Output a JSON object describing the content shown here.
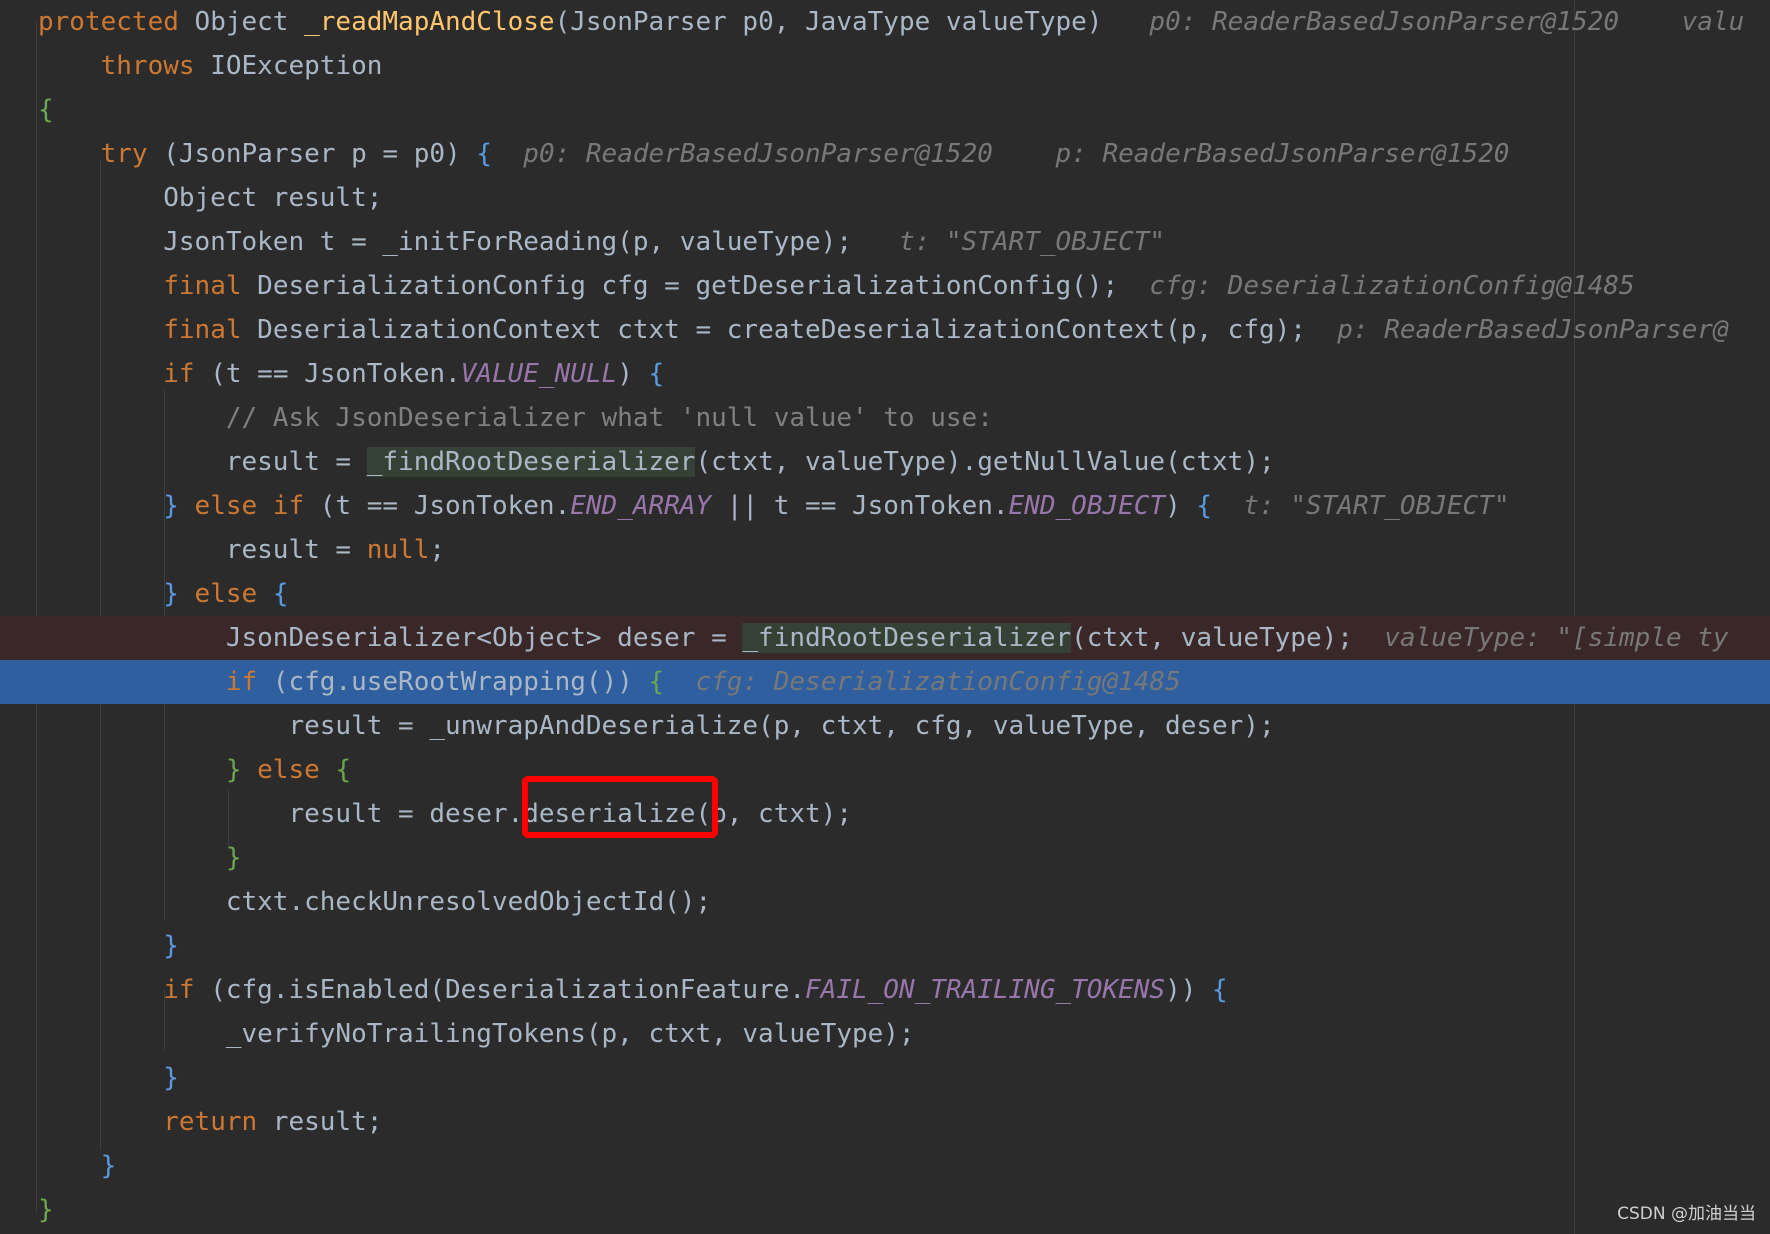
{
  "editor": {
    "lines": [
      {
        "segments": [
          {
            "t": "protected",
            "c": "kw"
          },
          {
            "t": " Object "
          },
          {
            "t": "_readMapAndClose",
            "c": "fn"
          },
          {
            "t": "(JsonParser p0, JavaType valueType)"
          },
          {
            "t": "   p0: ReaderBasedJsonParser@1520    valu",
            "c": "hint"
          }
        ]
      },
      {
        "segments": [
          {
            "t": "    "
          },
          {
            "t": "throws",
            "c": "kw"
          },
          {
            "t": " IOException"
          }
        ]
      },
      {
        "segments": [
          {
            "t": "{",
            "c": "br2"
          }
        ]
      },
      {
        "segments": [
          {
            "t": "    "
          },
          {
            "t": "try",
            "c": "kw"
          },
          {
            "t": " ("
          },
          {
            "t": "JsonParser p = p0) "
          },
          {
            "t": "{",
            "c": "br3"
          },
          {
            "t": "  p0: ReaderBasedJsonParser@1520    p: ReaderBasedJsonParser@1520",
            "c": "hint"
          }
        ]
      },
      {
        "segments": [
          {
            "t": "        Object result;"
          }
        ]
      },
      {
        "segments": [
          {
            "t": "        JsonToken t = _initForReading(p, valueType);"
          },
          {
            "t": "   t: \"START_OBJECT\"",
            "c": "hint"
          }
        ]
      },
      {
        "segments": [
          {
            "t": "        "
          },
          {
            "t": "final",
            "c": "kw"
          },
          {
            "t": " DeserializationConfig cfg = getDeserializationConfig();"
          },
          {
            "t": "  cfg: DeserializationConfig@1485",
            "c": "hint"
          }
        ]
      },
      {
        "segments": [
          {
            "t": "        "
          },
          {
            "t": "final",
            "c": "kw"
          },
          {
            "t": " DeserializationContext ctxt = createDeserializationContext(p, cfg);"
          },
          {
            "t": "  p: ReaderBasedJsonParser@",
            "c": "hint"
          }
        ]
      },
      {
        "segments": [
          {
            "t": "        "
          },
          {
            "t": "if",
            "c": "kw"
          },
          {
            "t": " (t == JsonToken."
          },
          {
            "t": "VALUE_NULL",
            "c": "const"
          },
          {
            "t": ") "
          },
          {
            "t": "{",
            "c": "br3"
          }
        ]
      },
      {
        "segments": [
          {
            "t": "            "
          },
          {
            "t": "// Ask JsonDeserializer what 'null value' to use:",
            "c": "cmt"
          }
        ]
      },
      {
        "segments": [
          {
            "t": "            result = "
          },
          {
            "t": "_findRootDeserializer",
            "c": "hl-usage"
          },
          {
            "t": "(ctxt, valueType).getNullValue(ctxt);"
          }
        ]
      },
      {
        "segments": [
          {
            "t": "        "
          },
          {
            "t": "}",
            "c": "br3"
          },
          {
            "t": " "
          },
          {
            "t": "else if",
            "c": "kw"
          },
          {
            "t": " (t == JsonToken."
          },
          {
            "t": "END_ARRAY",
            "c": "const"
          },
          {
            "t": " || t == JsonToken."
          },
          {
            "t": "END_OBJECT",
            "c": "const"
          },
          {
            "t": ") "
          },
          {
            "t": "{",
            "c": "br3"
          },
          {
            "t": "  t: \"START_OBJECT\"",
            "c": "hint"
          }
        ]
      },
      {
        "segments": [
          {
            "t": "            result = "
          },
          {
            "t": "null",
            "c": "kw"
          },
          {
            "t": ";"
          }
        ]
      },
      {
        "segments": [
          {
            "t": "        "
          },
          {
            "t": "}",
            "c": "br3"
          },
          {
            "t": " "
          },
          {
            "t": "else",
            "c": "kw"
          },
          {
            "t": " "
          },
          {
            "t": "{",
            "c": "br3"
          }
        ]
      },
      {
        "segments": [
          {
            "t": "            JsonDeserializer<Object> deser = "
          },
          {
            "t": "_findRootDeserializer",
            "c": "hl-usage"
          },
          {
            "t": "(ctxt, valueType);"
          },
          {
            "t": "  valueType: \"[simple ty",
            "c": "hint"
          }
        ]
      },
      {
        "segments": [
          {
            "t": "            "
          },
          {
            "t": "if",
            "c": "kw"
          },
          {
            "t": " (cfg.useRootWrapping()) "
          },
          {
            "t": "{",
            "c": "br2"
          },
          {
            "t": "  cfg: DeserializationConfig@1485",
            "c": "hint"
          }
        ]
      },
      {
        "segments": [
          {
            "t": "                result = _unwrapAndDeserialize(p, ctxt, cfg, valueType, deser);"
          }
        ]
      },
      {
        "segments": [
          {
            "t": "            "
          },
          {
            "t": "}",
            "c": "br2"
          },
          {
            "t": " "
          },
          {
            "t": "else",
            "c": "kw"
          },
          {
            "t": " "
          },
          {
            "t": "{",
            "c": "br2"
          }
        ]
      },
      {
        "segments": [
          {
            "t": "                result = deser.deserialize(p, ctxt);"
          }
        ]
      },
      {
        "segments": [
          {
            "t": "            "
          },
          {
            "t": "}",
            "c": "br2"
          }
        ]
      },
      {
        "segments": [
          {
            "t": "            ctxt.checkUnresolvedObjectId();"
          }
        ]
      },
      {
        "segments": [
          {
            "t": "        "
          },
          {
            "t": "}",
            "c": "br3"
          }
        ]
      },
      {
        "segments": [
          {
            "t": "        "
          },
          {
            "t": "if",
            "c": "kw"
          },
          {
            "t": " (cfg.isEnabled(DeserializationFeature."
          },
          {
            "t": "FAIL_ON_TRAILING_TOKENS",
            "c": "const"
          },
          {
            "t": ")) "
          },
          {
            "t": "{",
            "c": "br3"
          }
        ]
      },
      {
        "segments": [
          {
            "t": "            _verifyNoTrailingTokens(p, ctxt, valueType);"
          }
        ]
      },
      {
        "segments": [
          {
            "t": "        "
          },
          {
            "t": "}",
            "c": "br3"
          }
        ]
      },
      {
        "segments": [
          {
            "t": "        "
          },
          {
            "t": "return",
            "c": "kw"
          },
          {
            "t": " result;"
          }
        ]
      },
      {
        "segments": [
          {
            "t": "    "
          },
          {
            "t": "}",
            "c": "br3"
          }
        ]
      },
      {
        "segments": [
          {
            "t": "}",
            "c": "br2"
          }
        ]
      }
    ],
    "breakpoint_line": 14,
    "current_line": 15,
    "highlighted_call": "deserialize"
  },
  "colors": {
    "background": "#2b2b2b",
    "keyword": "#cc7832",
    "method_decl": "#ffc66d",
    "constant": "#9876aa",
    "comment": "#808080",
    "inline_hint": "#787878",
    "current_line": "#2f5f9f",
    "breakpoint_line": "#3a2727",
    "annotation_box": "#ff0000"
  },
  "watermark": "CSDN @加油当当"
}
